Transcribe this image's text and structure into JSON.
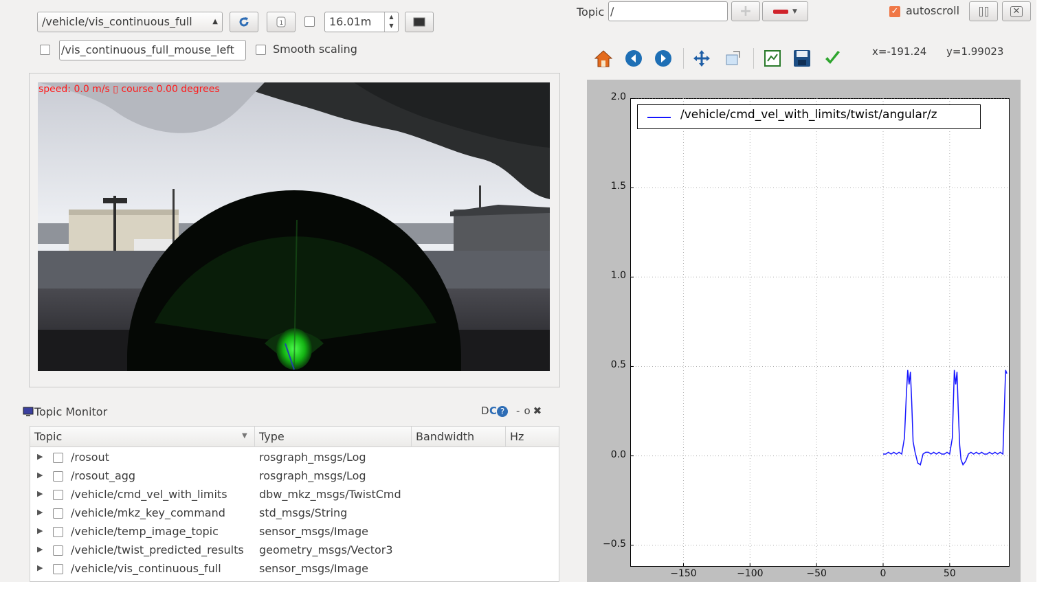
{
  "image_view": {
    "topic_combo": "/vehicle/vis_continuous_full",
    "max_range": "16.01m",
    "mouse_topic": "/vis_continuous_full_mouse_left",
    "smooth_scaling_label": "Smooth scaling",
    "overlay_text": "speed: 0.0 m/s ▯ course  0.00 degrees"
  },
  "plot": {
    "topic_label": "Topic",
    "topic_value": "/",
    "autoscroll_label": "autoscroll",
    "coord_x": "x=-191.24",
    "coord_y": "y=1.99023",
    "legend": "/vehicle/cmd_vel_with_limits/twist/angular/z"
  },
  "topic_monitor": {
    "title": "Topic Monitor",
    "header_icons": "DC",
    "columns": [
      "Topic",
      "Type",
      "Bandwidth",
      "Hz"
    ],
    "rows": [
      {
        "topic": "/rosout",
        "type": "rosgraph_msgs/Log"
      },
      {
        "topic": "/rosout_agg",
        "type": "rosgraph_msgs/Log"
      },
      {
        "topic": "/vehicle/cmd_vel_with_limits",
        "type": "dbw_mkz_msgs/TwistCmd"
      },
      {
        "topic": "/vehicle/mkz_key_command",
        "type": "std_msgs/String"
      },
      {
        "topic": "/vehicle/temp_image_topic",
        "type": "sensor_msgs/Image"
      },
      {
        "topic": "/vehicle/twist_predicted_results",
        "type": "geometry_msgs/Vector3"
      },
      {
        "topic": "/vehicle/vis_continuous_full",
        "type": "sensor_msgs/Image"
      }
    ]
  },
  "chart_data": {
    "type": "line",
    "title": "",
    "xlabel": "",
    "ylabel": "",
    "xlim": [
      -190,
      95
    ],
    "ylim": [
      -0.6,
      2.0
    ],
    "x_ticks": [
      "−150",
      "−100",
      "−50",
      "0",
      "50"
    ],
    "y_ticks": [
      "2.0",
      "1.5",
      "1.0",
      "0.5",
      "0.0",
      "−0.5"
    ],
    "grid": true,
    "legend_position": "top-left",
    "series": [
      {
        "name": "/vehicle/cmd_vel_with_limits/twist/angular/z",
        "color": "#1515ff",
        "x": [
          0,
          2,
          4,
          6,
          8,
          10,
          12,
          14,
          16,
          17.5,
          18.5,
          19.5,
          20.5,
          21.5,
          22.5,
          24,
          26,
          28,
          30,
          32,
          34,
          36,
          38,
          40,
          42,
          44,
          46,
          48,
          50,
          52,
          53.5,
          54.5,
          55.5,
          56.5,
          57.5,
          58.5,
          60,
          62,
          64,
          66,
          68,
          70,
          72,
          74,
          76,
          78,
          80,
          82,
          84,
          86,
          88,
          90,
          91,
          92,
          93
        ],
        "y": [
          0.01,
          0.01,
          0.02,
          0.01,
          0.02,
          0.01,
          0.02,
          0.01,
          0.1,
          0.35,
          0.48,
          0.4,
          0.47,
          0.3,
          0.08,
          0.02,
          -0.04,
          -0.05,
          0.01,
          0.02,
          0.02,
          0.01,
          0.02,
          0.01,
          0.02,
          0.01,
          0.01,
          0.02,
          0.01,
          0.1,
          0.48,
          0.4,
          0.47,
          0.25,
          0.06,
          -0.02,
          -0.05,
          -0.03,
          0.01,
          0.02,
          0.01,
          0.02,
          0.01,
          0.02,
          0.01,
          0.01,
          0.02,
          0.01,
          0.02,
          0.01,
          0.02,
          0.01,
          0.25,
          0.48,
          0.46
        ]
      }
    ]
  }
}
